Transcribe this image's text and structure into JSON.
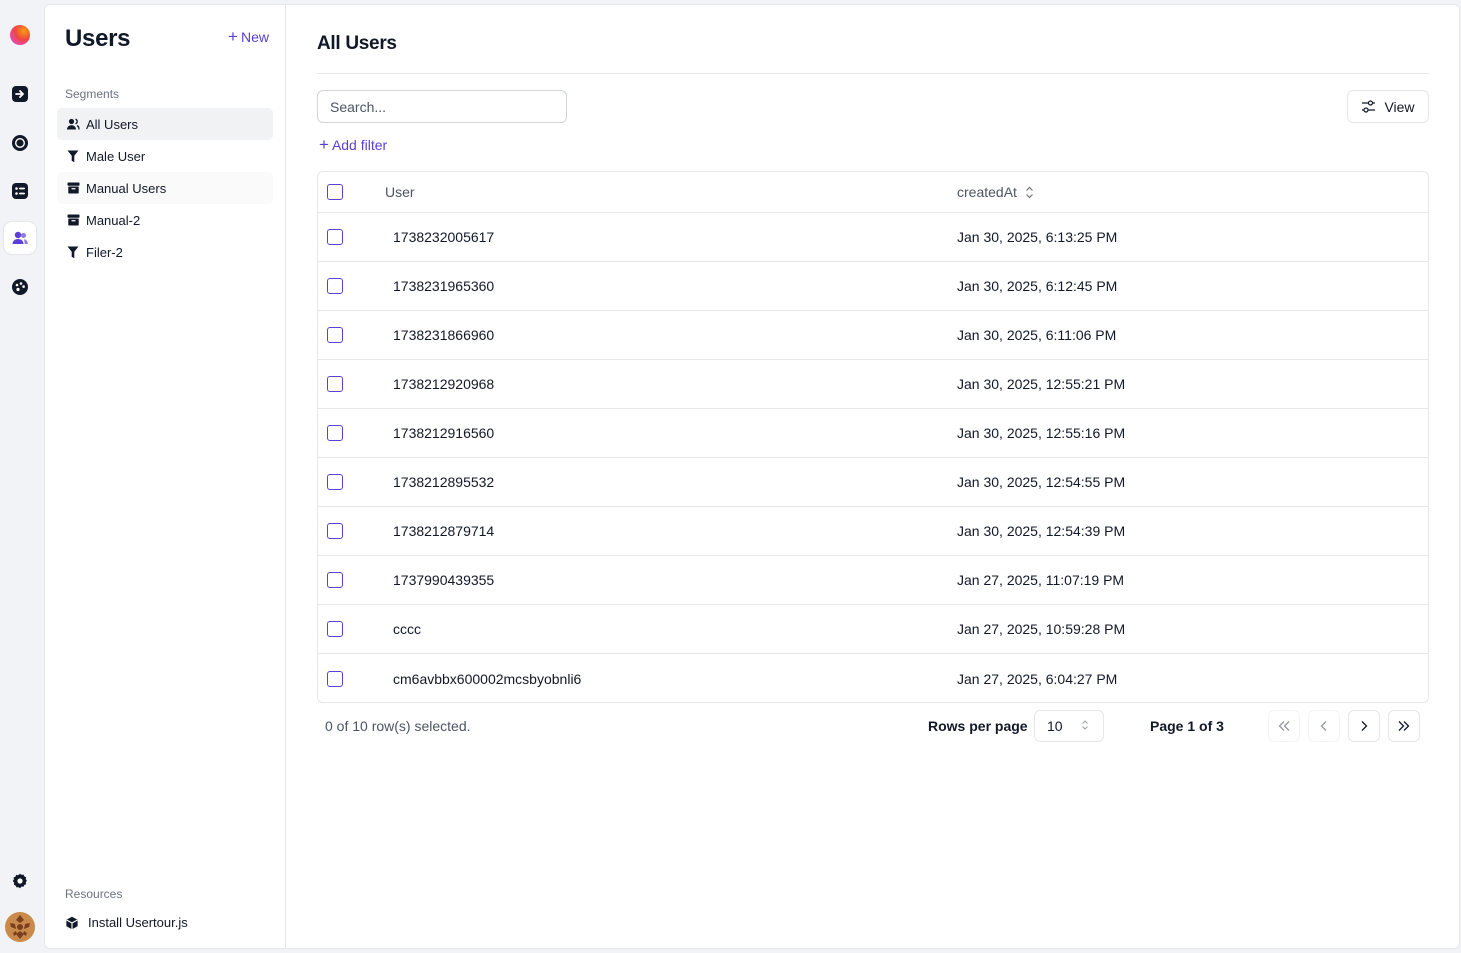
{
  "sidebar": {
    "title": "Users",
    "new_label": "New",
    "segments_label": "Segments",
    "segments": [
      {
        "label": "All Users",
        "icon": "users-icon"
      },
      {
        "label": "Male User",
        "icon": "filter-icon"
      },
      {
        "label": "Manual Users",
        "icon": "archive-icon"
      },
      {
        "label": "Manual-2",
        "icon": "archive-icon"
      },
      {
        "label": "Filer-2",
        "icon": "filter-icon"
      }
    ],
    "resources_label": "Resources",
    "install_label": "Install Usertour.js"
  },
  "main": {
    "title": "All Users",
    "search_placeholder": "Search...",
    "view_label": "View",
    "add_filter_label": "Add filter",
    "columns": {
      "user": "User",
      "created": "createdAt"
    },
    "rows": [
      {
        "user": "1738232005617",
        "created": "Jan 30, 2025, 6:13:25 PM"
      },
      {
        "user": "1738231965360",
        "created": "Jan 30, 2025, 6:12:45 PM"
      },
      {
        "user": "1738231866960",
        "created": "Jan 30, 2025, 6:11:06 PM"
      },
      {
        "user": "1738212920968",
        "created": "Jan 30, 2025, 12:55:21 PM"
      },
      {
        "user": "1738212916560",
        "created": "Jan 30, 2025, 12:55:16 PM"
      },
      {
        "user": "1738212895532",
        "created": "Jan 30, 2025, 12:54:55 PM"
      },
      {
        "user": "1738212879714",
        "created": "Jan 30, 2025, 12:54:39 PM"
      },
      {
        "user": "1737990439355",
        "created": "Jan 27, 2025, 11:07:19 PM"
      },
      {
        "user": "cccc",
        "created": "Jan 27, 2025, 10:59:28 PM"
      },
      {
        "user": "cm6avbbx600002mcsbyobnli6",
        "created": "Jan 27, 2025, 6:04:27 PM"
      }
    ],
    "selection_text": "0 of 10 row(s) selected.",
    "rows_per_page_label": "Rows per page",
    "rows_per_page_value": "10",
    "page_info": "Page 1 of 3"
  },
  "colors": {
    "accent": "#5b3fd6",
    "border": "#e5e7eb",
    "rail_bg": "#f1f3f6"
  }
}
